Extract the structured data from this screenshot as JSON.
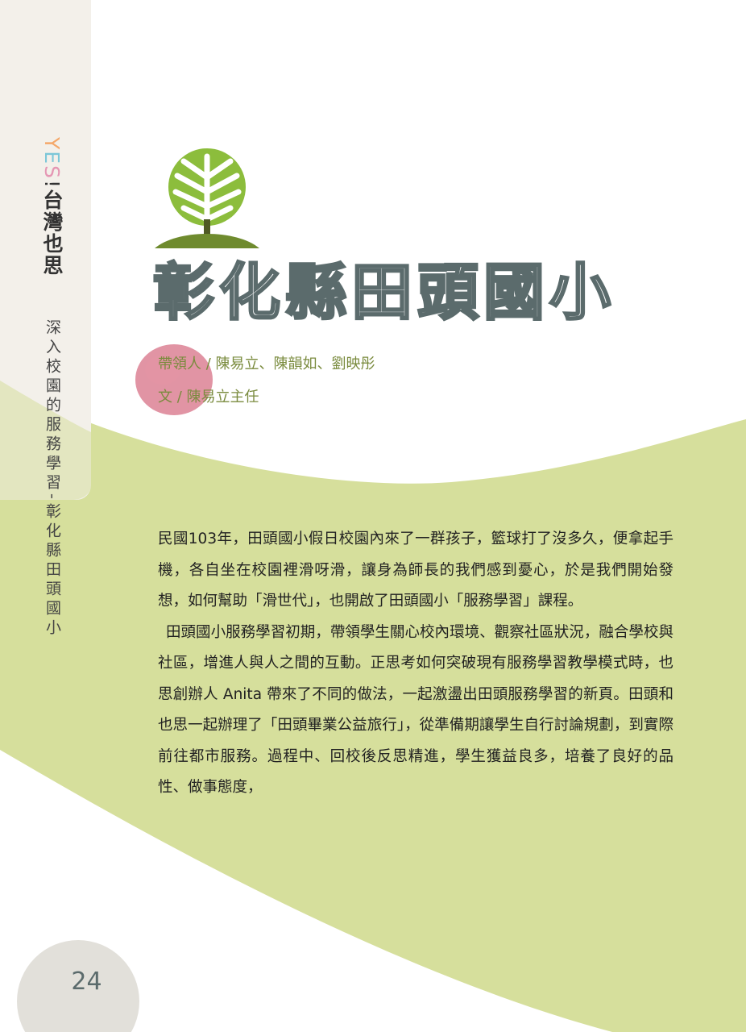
{
  "sidebar": {
    "title_letters": [
      "Y",
      "E",
      "S",
      "!"
    ],
    "title_rest": "台灣也思",
    "subtitle": "深入校園的服務學習-彰化縣田頭國小"
  },
  "article": {
    "title": "彰化縣田頭國小",
    "credits": [
      "帶領人 / 陳易立、陳韻如、劉映彤",
      "文 / 陳易立主任"
    ],
    "paragraphs": [
      "民國103年，田頭國小假日校園內來了一群孩子，籃球打了沒多久，便拿起手機，各自坐在校園裡滑呀滑，讓身為師長的我們感到憂心，於是我們開始發想，如何幫助「滑世代」，也開啟了田頭國小「服務學習」課程。",
      "田頭國小服務學習初期，帶領學生關心校內環境、觀察社區狀況，融合學校與社區，增進人與人之間的互動。正思考如何突破現有服務學習教學模式時，也思創辦人 Anita 帶來了不同的做法，一起激盪出田頭服務學習的新頁。田頭和也思一起辦理了「田頭畢業公益旅行」，從準備期讓學生自行討論規劃，到實際前往都市服務。過程中、回校後反思精進，學生獲益良多，培養了良好的品性、做事態度，"
    ]
  },
  "page_number": "24",
  "colors": {
    "green_wave": "#d6df9c",
    "tree_green": "#8cbd3c",
    "ground_green": "#6f8b2e",
    "blob_pink": "#d9768a",
    "sidebar_bg": "#f3f0ea",
    "page_circle": "#e2e0da"
  }
}
